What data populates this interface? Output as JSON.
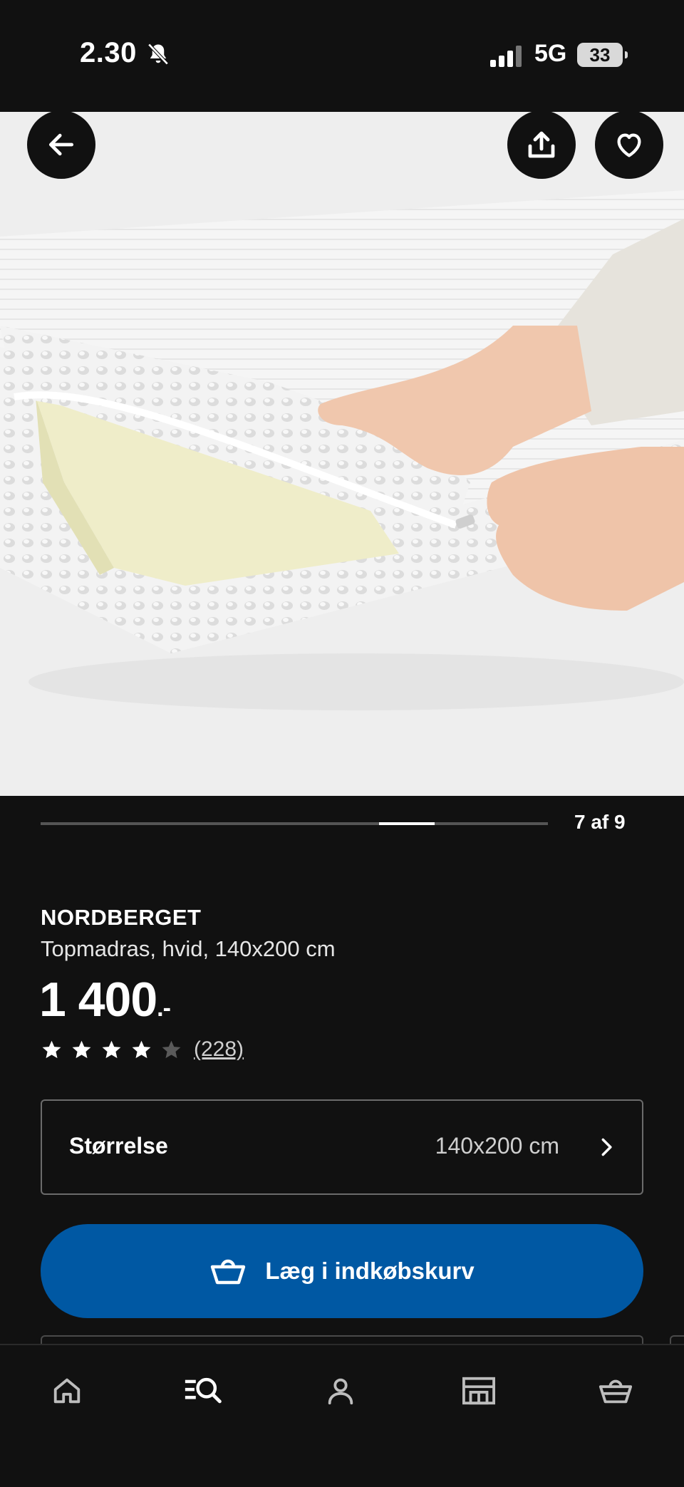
{
  "status_bar": {
    "time": "2.30",
    "network": "5G",
    "battery": "33",
    "icons": [
      "bell-muted-icon",
      "signal-icon",
      "battery-icon"
    ]
  },
  "hero": {
    "icons": [
      "back-arrow-icon",
      "share-icon",
      "heart-icon"
    ]
  },
  "carousel": {
    "counter": "7 af 9",
    "current": 7,
    "total": 9
  },
  "product": {
    "name": "NORDBERGET",
    "description": "Topmadras, hvid, 140x200 cm",
    "price": "1 400",
    "price_suffix": ".-",
    "rating": 4,
    "rating_max": 5,
    "reviews": "(228)"
  },
  "size_selector": {
    "label": "Størrelse",
    "value": "140x200 cm",
    "icon": "chevron-right-icon"
  },
  "add_to_cart": {
    "label": "Læg i indkøbskurv",
    "icon": "basket-icon",
    "color": "#0058a3"
  },
  "bottom_nav": {
    "items": [
      "home-icon",
      "search-icon",
      "profile-icon",
      "store-icon",
      "basket-icon"
    ],
    "active": "search-icon"
  },
  "colors": {
    "background": "#111111",
    "accent": "#0058a3"
  }
}
